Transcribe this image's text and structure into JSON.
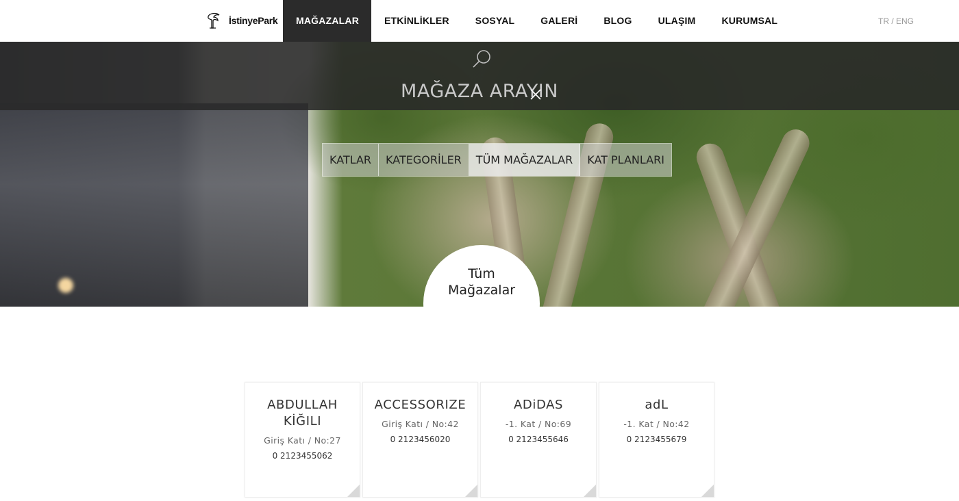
{
  "brand": {
    "name": "İstinyePark"
  },
  "nav": {
    "items": [
      {
        "label": "MAĞAZALAR",
        "active": true
      },
      {
        "label": "ETKİNLİKLER",
        "active": false
      },
      {
        "label": "SOSYAL",
        "active": false
      },
      {
        "label": "GALERİ",
        "active": false
      },
      {
        "label": "BLOG",
        "active": false
      },
      {
        "label": "ULAŞIM",
        "active": false
      },
      {
        "label": "KURUMSAL",
        "active": false
      }
    ],
    "language": "TR / ENG"
  },
  "search": {
    "title": "MAĞAZA ARAYIN",
    "icon": "search-icon",
    "close_icon": "close-icon"
  },
  "tabs": [
    {
      "label": "KATLAR",
      "active": false
    },
    {
      "label": "KATEGORİLER",
      "active": false
    },
    {
      "label": "TÜM MAĞAZALAR",
      "active": true
    },
    {
      "label": "KAT PLANLARI",
      "active": false
    }
  ],
  "section": {
    "title": "Tüm\nMağazalar"
  },
  "stores": [
    {
      "name": "ABDULLAH\nKİĞILI",
      "location": "Giriş Katı / No:27",
      "phone": "0 2123455062"
    },
    {
      "name": "ACCESSORIZE",
      "location": "Giriş Katı / No:42",
      "phone": "0 2123456020"
    },
    {
      "name": "ADiDAS",
      "location": "-1. Kat / No:69",
      "phone": "0 2123455646"
    },
    {
      "name": "adL",
      "location": "-1. Kat / No:42",
      "phone": "0 2123455679"
    }
  ],
  "colors": {
    "nav_active_bg": "#2b2b2b",
    "search_band_bg": "#282828",
    "card_corner": "#d9d9d9"
  }
}
